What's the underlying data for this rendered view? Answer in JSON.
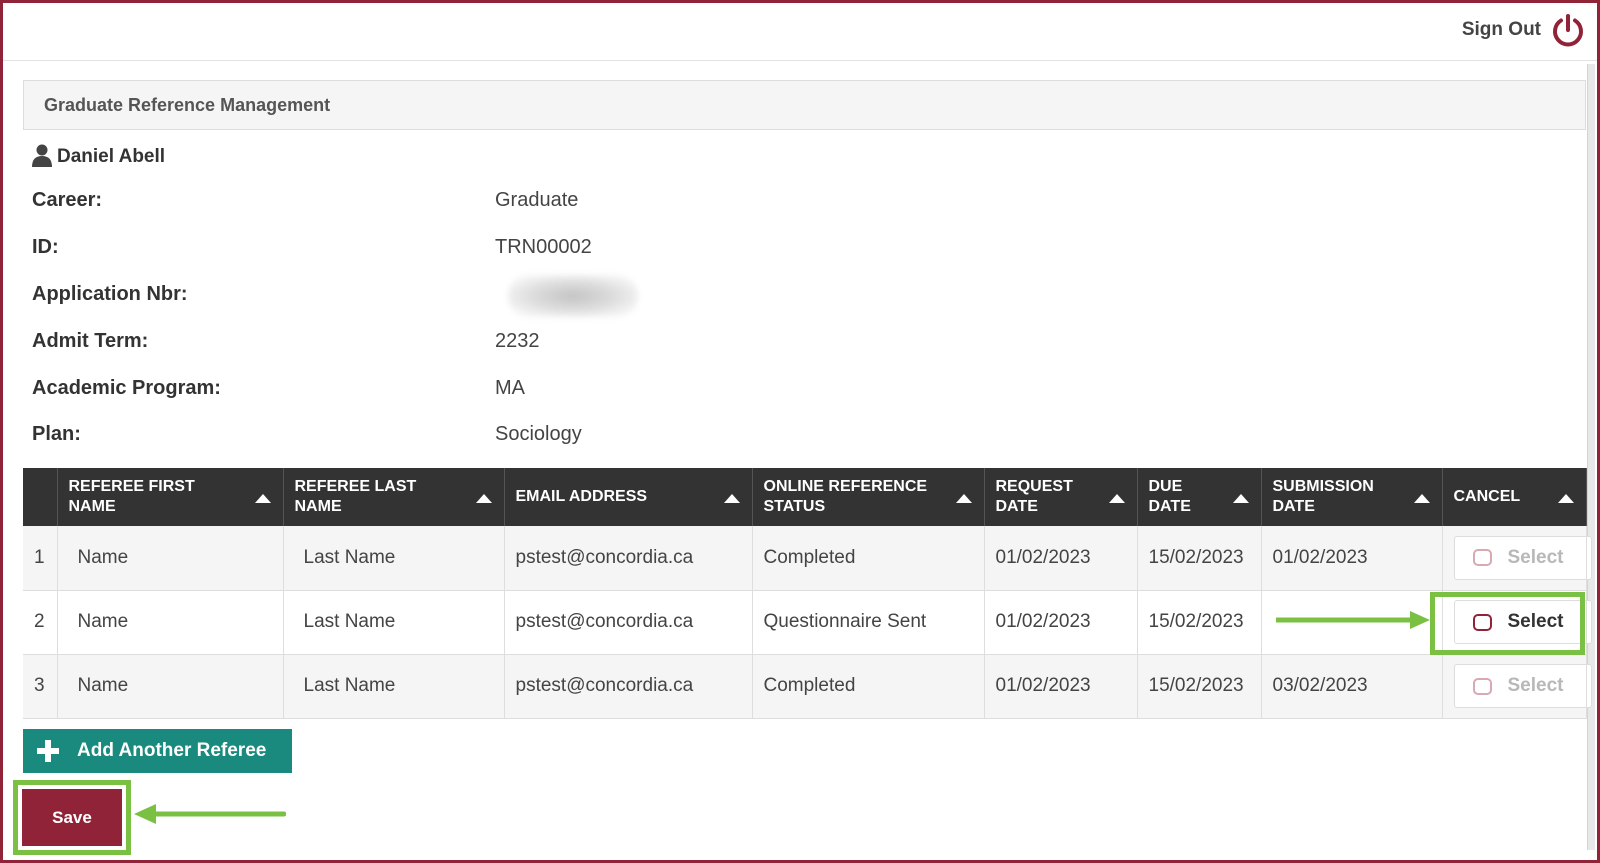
{
  "header": {
    "sign_out_label": "Sign Out",
    "icon": "power-icon"
  },
  "panel": {
    "title": "Graduate Reference Management"
  },
  "student": {
    "name": "Daniel Abell",
    "icon": "user-icon",
    "fields": [
      {
        "label": "Career:",
        "value": "Graduate"
      },
      {
        "label": "ID:",
        "value": "TRN00002"
      },
      {
        "label": "Application Nbr:",
        "value": ""
      },
      {
        "label": "Admit Term:",
        "value": "2232"
      },
      {
        "label": "Academic Program:",
        "value": "MA"
      },
      {
        "label": "Plan:",
        "value": "Sociology"
      }
    ]
  },
  "table": {
    "columns": [
      "REFEREE FIRST NAME",
      "REFEREE LAST NAME",
      "EMAIL ADDRESS",
      "ONLINE REFERENCE STATUS",
      "REQUEST DATE",
      "DUE DATE",
      "SUBMISSION DATE",
      "CANCEL"
    ],
    "rows": [
      {
        "num": "1",
        "first": "Name",
        "last": "Last Name",
        "email": "pstest@concordia.ca",
        "status": "Completed",
        "request": "01/02/2023",
        "due": "15/02/2023",
        "submission": "01/02/2023",
        "cancel_label": "Select"
      },
      {
        "num": "2",
        "first": "Name",
        "last": "Last Name",
        "email": "pstest@concordia.ca",
        "status": "Questionnaire Sent",
        "request": "01/02/2023",
        "due": "15/02/2023",
        "submission": "",
        "cancel_label": "Select"
      },
      {
        "num": "3",
        "first": "Name",
        "last": "Last Name",
        "email": "pstest@concordia.ca",
        "status": "Completed",
        "request": "01/02/2023",
        "due": "15/02/2023",
        "submission": "03/02/2023",
        "cancel_label": "Select"
      }
    ]
  },
  "actions": {
    "add_referee_label": "Add Another Referee",
    "save_label": "Save"
  },
  "colors": {
    "brand": "#912338",
    "teal": "#1a8a7e",
    "highlight": "#7ac143",
    "table_header": "#333333"
  }
}
